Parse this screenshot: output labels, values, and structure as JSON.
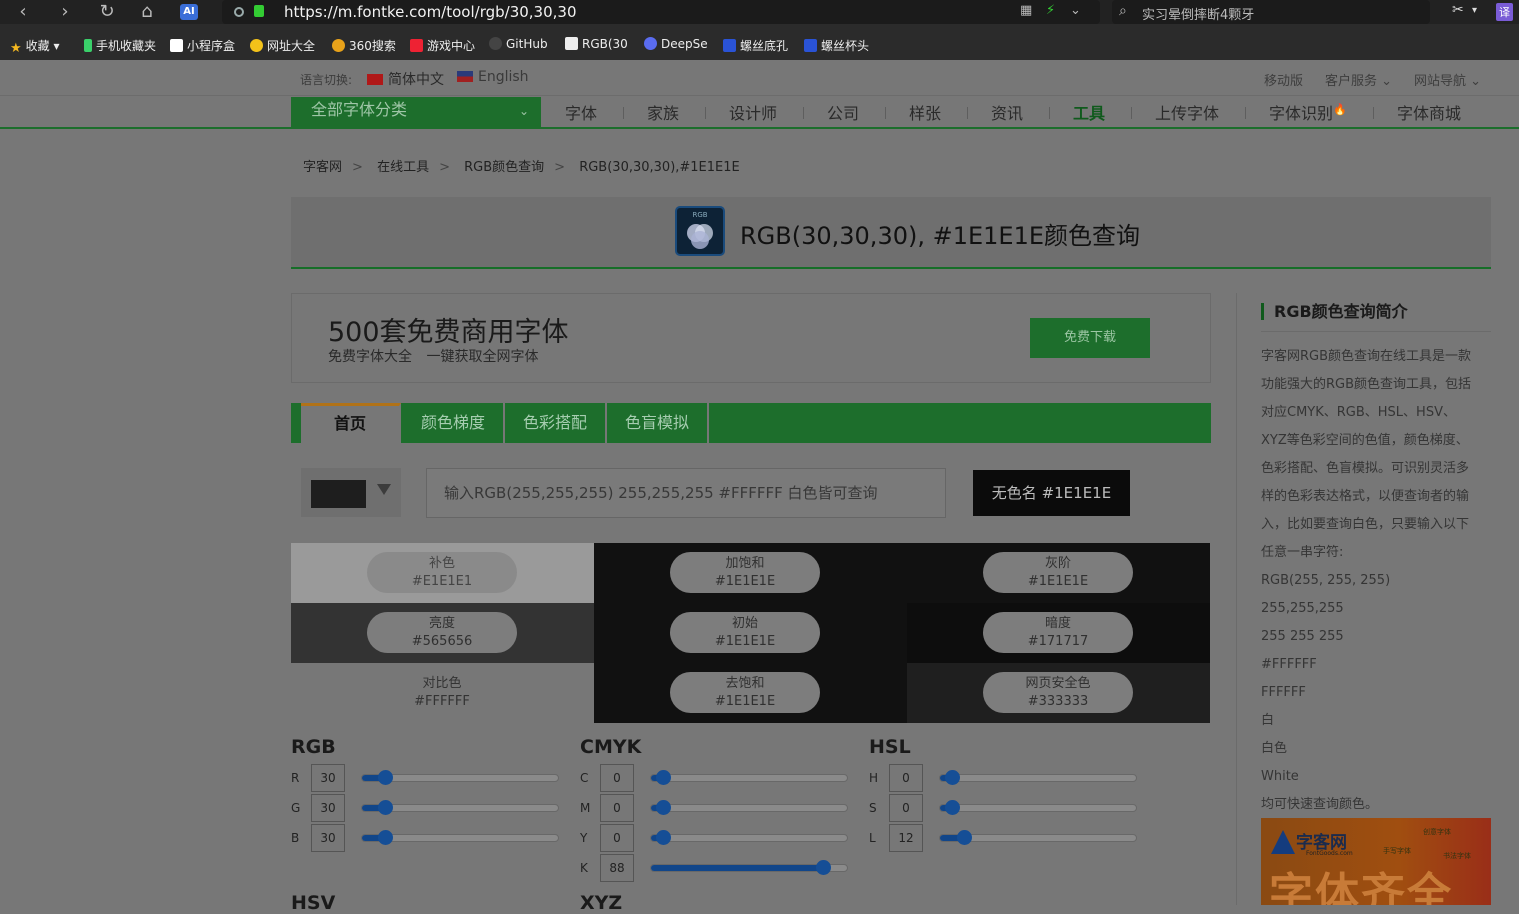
{
  "browser": {
    "url": "https://m.fontke.com/tool/rgb/30,30,30",
    "search_text": "实习晕倒摔断4颗牙",
    "ai_label": "AI",
    "translate_label": "译",
    "bookmarks": [
      "收藏",
      "手机收藏夹",
      "小程序盒",
      "网址大全",
      "360搜索",
      "游戏中心",
      "GitHub",
      "RGB(30",
      "DeepSe",
      "螺丝底孔",
      "螺丝杯头"
    ]
  },
  "langbar": {
    "label": "语言切换:",
    "langs": [
      "简体中文",
      "English"
    ],
    "links": [
      "移动版",
      "客户服务",
      "网站导航"
    ]
  },
  "nav": {
    "all_categories": "全部字体分类",
    "items": [
      "字体",
      "家族",
      "设计师",
      "公司",
      "样张",
      "资讯",
      "工具",
      "上传字体",
      "字体识别",
      "字体商城"
    ],
    "active": "工具"
  },
  "breadcrumb": [
    "字客网",
    "在线工具",
    "RGB颜色查询",
    "RGB(30,30,30),#1E1E1E"
  ],
  "breadcrumb_sep": ">",
  "title": {
    "icon_text": "RGB",
    "text": "RGB(30,30,30), #1E1E1E颜色查询"
  },
  "ad": {
    "headline": "500套免费商用字体",
    "subline": "免费字体大全 一键获取全网字体",
    "button": "免费下载"
  },
  "tabs": [
    "首页",
    "颜色梯度",
    "色彩搭配",
    "色盲模拟"
  ],
  "input": {
    "placeholder": "输入RGB(255,255,255) 255,255,255 #FFFFFF 白色皆可查询",
    "name_button": "无色名 #1E1E1E"
  },
  "colors": {
    "accent": "#1d6e2c",
    "current": "#1E1E1E"
  },
  "swatches": [
    {
      "name": "补色",
      "hex": "#E1E1E1",
      "bg": "#9a9a9a"
    },
    {
      "name": "加饱和",
      "hex": "#1E1E1E",
      "bg": "#111111"
    },
    {
      "name": "灰阶",
      "hex": "#1E1E1E",
      "bg": "#111111"
    },
    {
      "name": "亮度",
      "hex": "#565656",
      "bg": "#333333"
    },
    {
      "name": "初始",
      "hex": "#1E1E1E",
      "bg": "#111111"
    },
    {
      "name": "暗度",
      "hex": "#171717",
      "bg": "#0d0d0d"
    },
    {
      "name": "对比色",
      "hex": "#FFFFFF",
      "bg": "#777777"
    },
    {
      "name": "去饱和",
      "hex": "#1E1E1E",
      "bg": "#111111"
    },
    {
      "name": "网页安全色",
      "hex": "#333333",
      "bg": "#1f1f1f"
    }
  ],
  "sliders": {
    "rgb": {
      "title": "RGB",
      "rows": [
        {
          "label": "R",
          "value": "30",
          "pct": 0.1176
        },
        {
          "label": "G",
          "value": "30",
          "pct": 0.1176
        },
        {
          "label": "B",
          "value": "30",
          "pct": 0.1176
        }
      ]
    },
    "cmyk": {
      "title": "CMYK",
      "rows": [
        {
          "label": "C",
          "value": "0",
          "pct": 0
        },
        {
          "label": "M",
          "value": "0",
          "pct": 0
        },
        {
          "label": "Y",
          "value": "0",
          "pct": 0
        },
        {
          "label": "K",
          "value": "88",
          "pct": 0.88
        }
      ]
    },
    "hsl": {
      "title": "HSL",
      "rows": [
        {
          "label": "H",
          "value": "0",
          "pct": 0
        },
        {
          "label": "S",
          "value": "0",
          "pct": 0
        },
        {
          "label": "L",
          "value": "12",
          "pct": 0.12
        }
      ]
    }
  },
  "cut_titles": [
    "HSV",
    "XYZ"
  ],
  "sidebar": {
    "heading": "RGB颜色查询简介",
    "intro": [
      "字客网RGB颜色查询在线工具是一款",
      "功能强大的RGB颜色查询工具，包括",
      "对应CMYK、RGB、HSL、HSV、",
      "XYZ等色彩空间的色值，颜色梯度、",
      "色彩搭配、色盲模拟。可识别灵活多",
      "样的色彩表达格式，以便查询者的输",
      "入，比如要查询白色，只要输入以下",
      "任意一串字符:"
    ],
    "examples": [
      "RGB(255, 255, 255)",
      "255,255,255",
      "255 255 255",
      "#FFFFFF",
      "FFFFFF",
      "白",
      "白色",
      "White",
      "均可快速查询颜色。"
    ],
    "banner": {
      "brand": "字客网",
      "domain": "FontGoods.com",
      "big": "字体齐全",
      "tags": [
        "创意字体",
        "手写字体",
        "书法字体"
      ]
    }
  }
}
